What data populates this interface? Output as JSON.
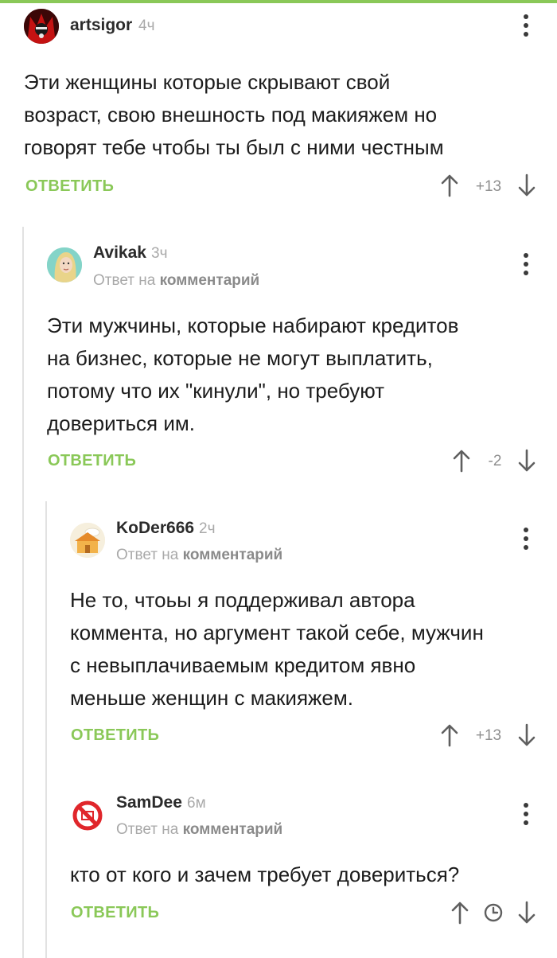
{
  "comments": [
    {
      "author": "artsigor",
      "time": "4ч",
      "text": [
        "Эти женщины которые скрывают свой",
        "возраст, свою внешность под макияжем но",
        "говорят тебе чтобы ты был с ними честным"
      ],
      "reply_label": "ОТВЕТИТЬ",
      "rating": "+13",
      "avatar_icon": "dark-red-avatar"
    },
    {
      "author": "Avikak",
      "time": "3ч",
      "reply_prefix": "Ответ на",
      "reply_target": "комментарий",
      "text": [
        "Эти мужчины, которые набирают кредитов",
        "на бизнес, которые не могут выплатить,",
        "потому что их \"кинули\", но требуют",
        "довериться им."
      ],
      "reply_label": "ОТВЕТИТЬ",
      "rating": "-2",
      "avatar_icon": "cartoon-girl-avatar"
    },
    {
      "author": "KoDer666",
      "time": "2ч",
      "reply_prefix": "Ответ на",
      "reply_target": "комментарий",
      "text": [
        "Не то, чтоьы я поддерживал автора",
        "коммента, но аргумент такой себе, мужчин",
        "с невыплачиваемым кредитом явно",
        "меньше женщин с макияжем."
      ],
      "reply_label": "ОТВЕТИТЬ",
      "rating": "+13",
      "avatar_icon": "house-cloud-avatar"
    },
    {
      "author": "SamDee",
      "time": "6м",
      "reply_prefix": "Ответ на",
      "reply_target": "комментарий",
      "text": [
        "кто от кого и зачем требует довериться?"
      ],
      "reply_label": "ОТВЕТИТЬ",
      "rating_icon": "clock-icon",
      "avatar_icon": "red-prohibited-avatar"
    }
  ],
  "colors": {
    "accent": "#8ac858",
    "muted": "#a9a9a9",
    "text": "#1c1c1c"
  }
}
